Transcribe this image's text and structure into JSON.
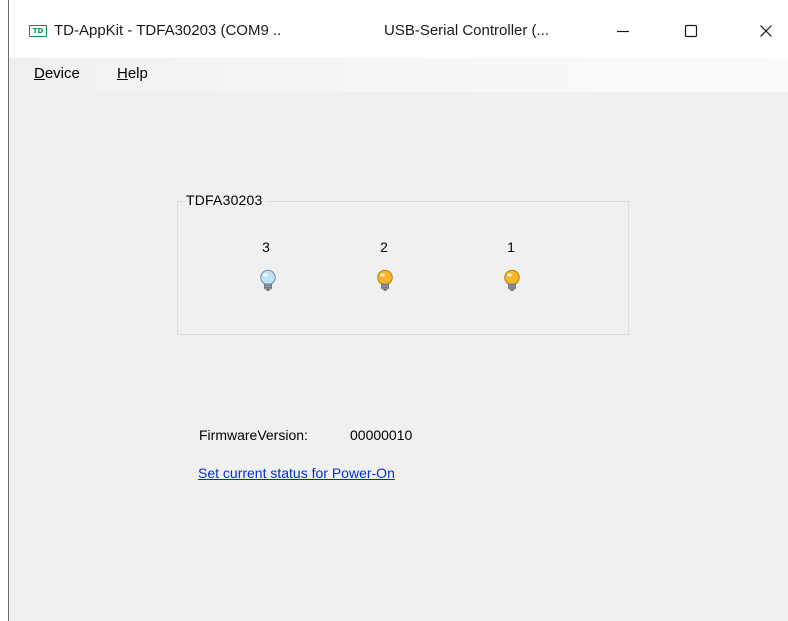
{
  "window": {
    "app_icon_text": "TD",
    "title": "TD-AppKit - TDFA30203 (COM9 ..",
    "subtitle": "USB-Serial Controller (...",
    "minimize_icon": "minimize-icon",
    "maximize_icon": "maximize-icon",
    "close_icon": "close-icon"
  },
  "menu": {
    "items": [
      {
        "accel": "D",
        "rest": "evice"
      },
      {
        "accel": "H",
        "rest": "elp"
      }
    ]
  },
  "device_group": {
    "label": "TDFA30203",
    "leds": [
      {
        "number": "3",
        "state": "off",
        "color": "#bfe3f5"
      },
      {
        "number": "2",
        "state": "on",
        "color": "#f5b62a"
      },
      {
        "number": "1",
        "state": "on",
        "color": "#f5b62a"
      }
    ]
  },
  "firmware": {
    "label": "FirmwareVersion:",
    "value": "00000010"
  },
  "power_on_link": "Set current status for Power-On"
}
